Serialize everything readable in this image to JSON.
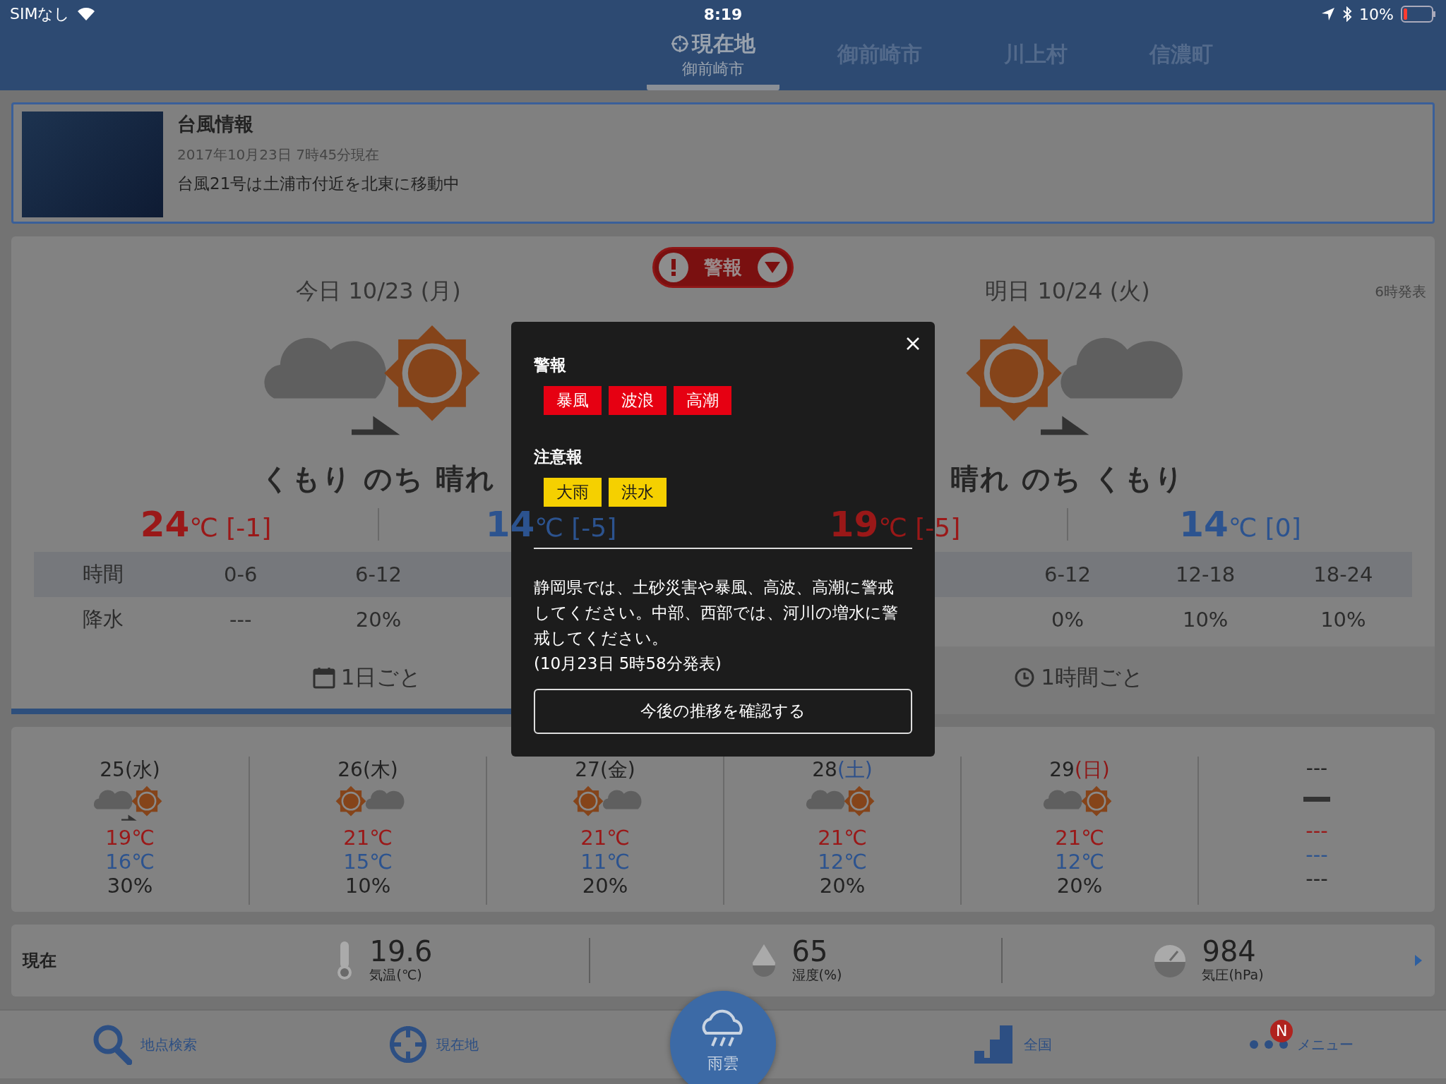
{
  "status_bar": {
    "carrier": "SIMなし",
    "time": "8:19",
    "battery": "10%"
  },
  "location_tabs": [
    {
      "label": "現在地",
      "sublabel": "御前崎市",
      "kind": "current",
      "selected": true
    },
    {
      "label": "御前崎市",
      "kind": "place",
      "selected": false
    },
    {
      "label": "川上村",
      "kind": "place",
      "selected": false
    },
    {
      "label": "信濃町",
      "kind": "place",
      "selected": false
    }
  ],
  "typhoon": {
    "title": "台風情報",
    "timestamp": "2017年10月23日 7時45分現在",
    "message": "台風21号は土浦市付近を北東に移動中"
  },
  "alert_button": {
    "label": "警報"
  },
  "forecast": {
    "days": [
      {
        "title": "今日 10/23 (月)",
        "sky": [
          {
            "kind": "cloud"
          },
          {
            "kind": "sun"
          }
        ],
        "later": true,
        "summary": "くもり のち 晴れ",
        "high": {
          "value": "24",
          "unit": "℃",
          "diff": "[-1]"
        },
        "low": {
          "value": "14",
          "unit": "℃",
          "diff": "[-5]"
        },
        "rows": [
          {
            "label": "時間",
            "cells": [
              "0-6",
              "6-12"
            ]
          },
          {
            "label": "降水",
            "cells": [
              "---",
              "20%"
            ]
          }
        ]
      },
      {
        "title": "明日 10/24 (火)",
        "note": "6時発表",
        "sky": [
          {
            "kind": "sun"
          },
          {
            "kind": "cloud"
          }
        ],
        "later": true,
        "summary": "晴れ のち くもり",
        "high": {
          "value": "19",
          "unit": "℃",
          "diff": "[-5]"
        },
        "low": {
          "value": "14",
          "unit": "℃",
          "diff": "[0]"
        },
        "rows": [
          {
            "cells": [
              "6-12",
              "12-18",
              "18-24"
            ]
          },
          {
            "cells": [
              "0%",
              "10%",
              "10%"
            ]
          }
        ]
      }
    ],
    "tabs": [
      {
        "label": "1日ごと",
        "kind": "daily",
        "selected": true
      },
      {
        "label": "1時間ごと",
        "kind": "hourly",
        "selected": false
      }
    ]
  },
  "week": [
    {
      "kind": "day",
      "date": "25",
      "weekday": "(水)",
      "color": "#222222",
      "sky": [
        {
          "kind": "cloud"
        },
        {
          "kind": "sun"
        }
      ],
      "later": true,
      "high": "19℃",
      "low": "16℃",
      "rain": "30%"
    },
    {
      "kind": "day",
      "date": "26",
      "weekday": "(木)",
      "color": "#222222",
      "sky": [
        {
          "kind": "sun"
        },
        {
          "kind": "cloud"
        }
      ],
      "later": false,
      "high": "21℃",
      "low": "15℃",
      "rain": "10%"
    },
    {
      "kind": "day",
      "date": "27",
      "weekday": "(金)",
      "color": "#222222",
      "sky": [
        {
          "kind": "sun"
        },
        {
          "kind": "cloud"
        }
      ],
      "later": false,
      "high": "21℃",
      "low": "11℃",
      "rain": "20%"
    },
    {
      "kind": "day",
      "date": "28",
      "weekday": "(土)",
      "color": "#2c4f8a",
      "sky": [
        {
          "kind": "cloud"
        },
        {
          "kind": "sun"
        }
      ],
      "later": false,
      "high": "21℃",
      "low": "12℃",
      "rain": "20%"
    },
    {
      "kind": "day",
      "date": "29",
      "weekday": "(日)",
      "color": "#8e1616",
      "sky": [
        {
          "kind": "cloud"
        },
        {
          "kind": "sun"
        }
      ],
      "later": false,
      "high": "21℃",
      "low": "12℃",
      "rain": "20%"
    },
    {
      "kind": "empty",
      "date": "---",
      "high": "---",
      "low": "---",
      "rain": "---"
    }
  ],
  "current": {
    "label": "現在",
    "readings": [
      {
        "kind": "temperature",
        "value": "19.6",
        "label": "気温(℃)"
      },
      {
        "kind": "humidity",
        "value": "65",
        "label": "湿度(%)"
      },
      {
        "kind": "pressure",
        "value": "984",
        "label": "気圧(hPa)"
      }
    ]
  },
  "nav": [
    {
      "kind": "search",
      "label": "地点検索"
    },
    {
      "kind": "location",
      "label": "現在地"
    },
    {
      "kind": "rain",
      "label": "雨雲"
    },
    {
      "kind": "nation",
      "label": "全国"
    },
    {
      "kind": "menu",
      "label": "メニュー",
      "badge": "N"
    }
  ],
  "modal": {
    "sections": [
      {
        "kind": "warning",
        "title": "警報",
        "tags": [
          "暴風",
          "波浪",
          "高潮"
        ]
      },
      {
        "kind": "advisory",
        "title": "注意報",
        "tags": [
          "大雨",
          "洪水"
        ]
      }
    ],
    "text": "静岡県では、土砂災害や暴風、高波、高潮に警戒してください。中部、西部では、河川の増水に警戒してください。",
    "issued": "(10月23日 5時58分発表)",
    "button": "今後の推移を確認する"
  }
}
